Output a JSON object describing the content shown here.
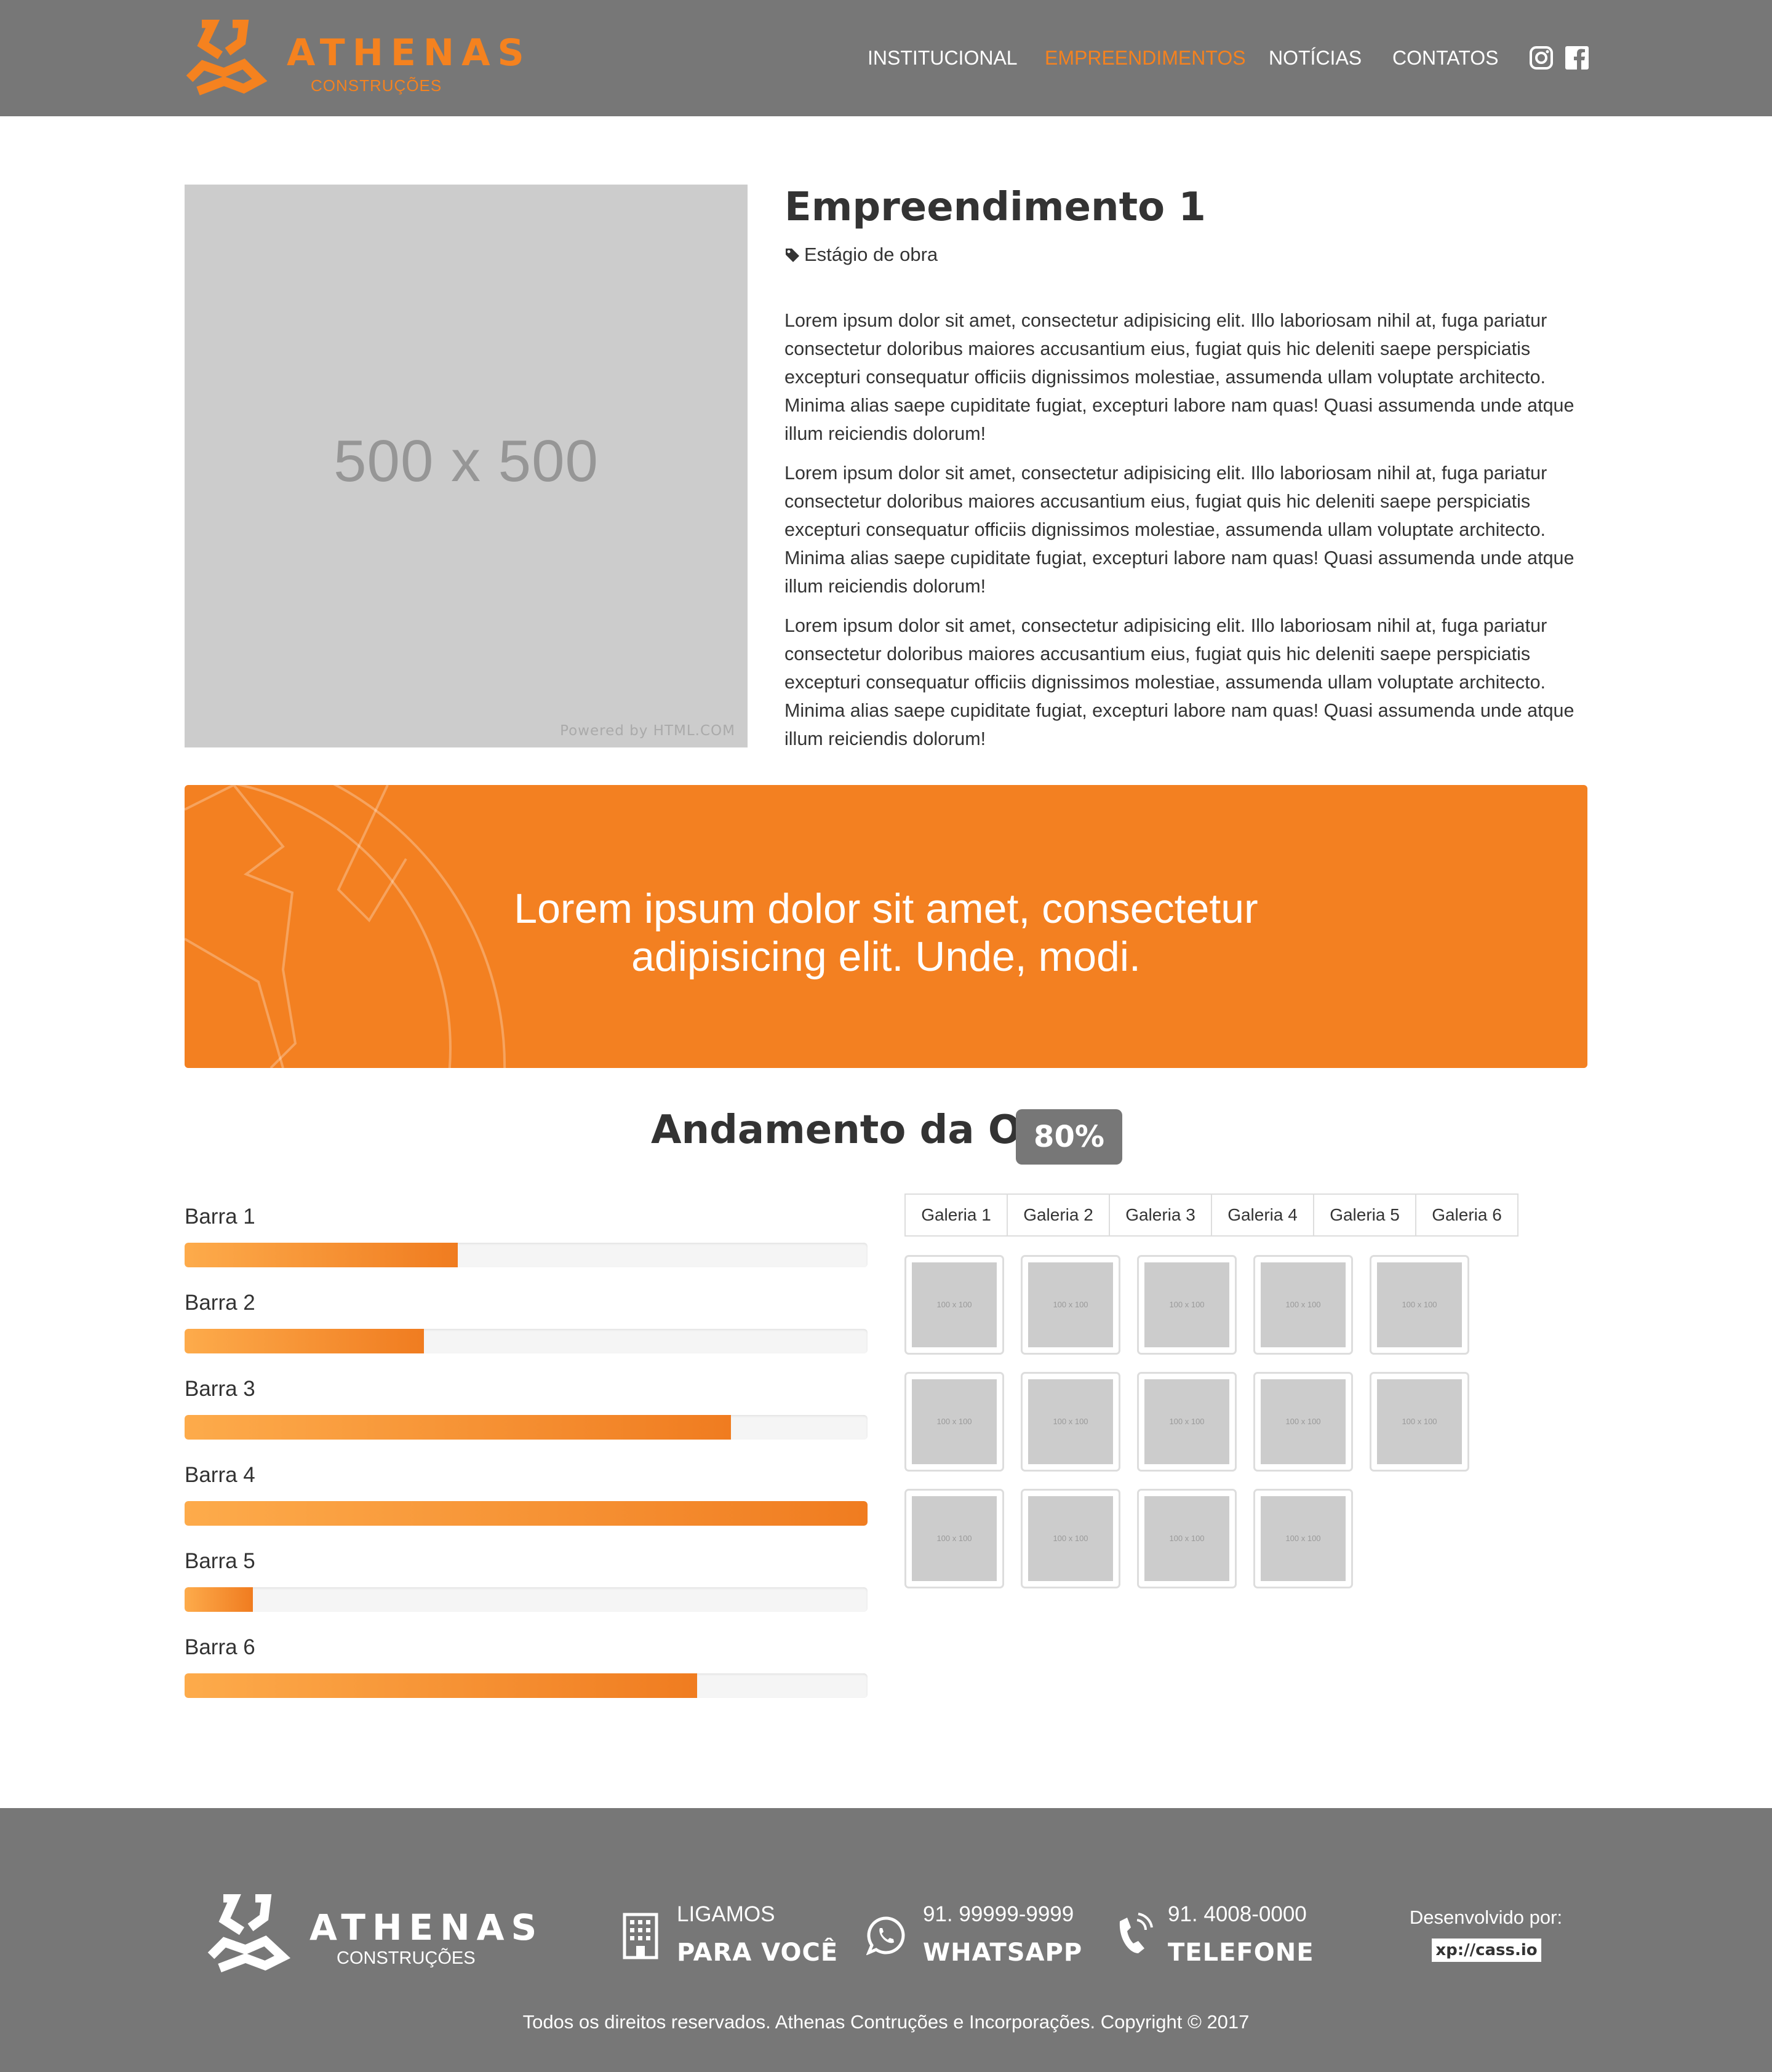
{
  "header": {
    "logo_text": "ATHENAS",
    "logo_sub": "CONSTRUÇÕES",
    "nav": [
      "INSTITUCIONAL",
      "EMPREENDIMENTOS",
      "NOTÍCIAS",
      "CONTATOS"
    ],
    "active_nav": "EMPREENDIMENTOS",
    "social_icons": [
      "instagram-icon",
      "facebook-icon"
    ]
  },
  "project": {
    "image_placeholder": "500 x 500",
    "image_powered": "Powered by HTML.COM",
    "title": "Empreendimento 1",
    "stage_icon": "tag-icon",
    "stage": "Estágio de obra",
    "paragraphs": [
      "Lorem ipsum dolor sit amet, consectetur adipisicing elit. Illo laboriosam nihil at, fuga pariatur consectetur doloribus maiores accusantium eius, fugiat quis hic deleniti saepe perspiciatis excepturi consequatur officiis dignissimos molestiae, assumenda ullam voluptate architecto. Minima alias saepe cupiditate fugiat, excepturi labore nam quas! Quasi assumenda unde atque illum reiciendis dolorum!",
      "Lorem ipsum dolor sit amet, consectetur adipisicing elit. Illo laboriosam nihil at, fuga pariatur consectetur doloribus maiores accusantium eius, fugiat quis hic deleniti saepe perspiciatis excepturi consequatur officiis dignissimos molestiae, assumenda ullam voluptate architecto. Minima alias saepe cupiditate fugiat, excepturi labore nam quas! Quasi assumenda unde atque illum reiciendis dolorum!",
      "Lorem ipsum dolor sit amet, consectetur adipisicing elit. Illo laboriosam nihil at, fuga pariatur consectetur doloribus maiores accusantium eius, fugiat quis hic deleniti saepe perspiciatis excepturi consequatur officiis dignissimos molestiae, assumenda ullam voluptate architecto. Minima alias saepe cupiditate fugiat, excepturi labore nam quas! Quasi assumenda unde atque illum reiciendis dolorum!"
    ]
  },
  "banner": {
    "line1": "Lorem ipsum dolor sit amet, consectetur",
    "line2": "adipisicing elit. Unde, modi."
  },
  "progress": {
    "title": "Andamento da Obra",
    "badge": "80%",
    "bars": [
      {
        "label": "Barra 1",
        "percent": 40
      },
      {
        "label": "Barra 2",
        "percent": 35
      },
      {
        "label": "Barra 3",
        "percent": 80
      },
      {
        "label": "Barra 4",
        "percent": 100
      },
      {
        "label": "Barra 5",
        "percent": 10
      },
      {
        "label": "Barra 6",
        "percent": 75
      }
    ]
  },
  "gallery": {
    "tabs": [
      "Galeria 1",
      "Galeria 2",
      "Galeria 3",
      "Galeria 4",
      "Galeria 5",
      "Galeria 6"
    ],
    "thumb_label": "100 x 100",
    "thumb_count": 14
  },
  "footer": {
    "logo_text": "ATHENAS",
    "logo_sub": "CONSTRUÇÕES",
    "contacts": [
      {
        "icon": "building-icon",
        "line1": "LIGAMOS",
        "line2": "PARA VOCÊ"
      },
      {
        "icon": "whatsapp-icon",
        "line1": "91. 99999-9999",
        "line2": "WHATSAPP"
      },
      {
        "icon": "phone-icon",
        "line1": "91. 4008-0000",
        "line2": "TELEFONE"
      }
    ],
    "dev_label": "Desenvolvido por:",
    "dev_badge": "xp://cass.io",
    "copyright": "Todos os direitos reservados. Athenas Contruções e Incorporações. Copyright © 2017"
  },
  "colors": {
    "accent": "#f5821f",
    "header_bg": "#777777",
    "banner_bg": "#f38021",
    "placeholder": "#cccccc"
  }
}
